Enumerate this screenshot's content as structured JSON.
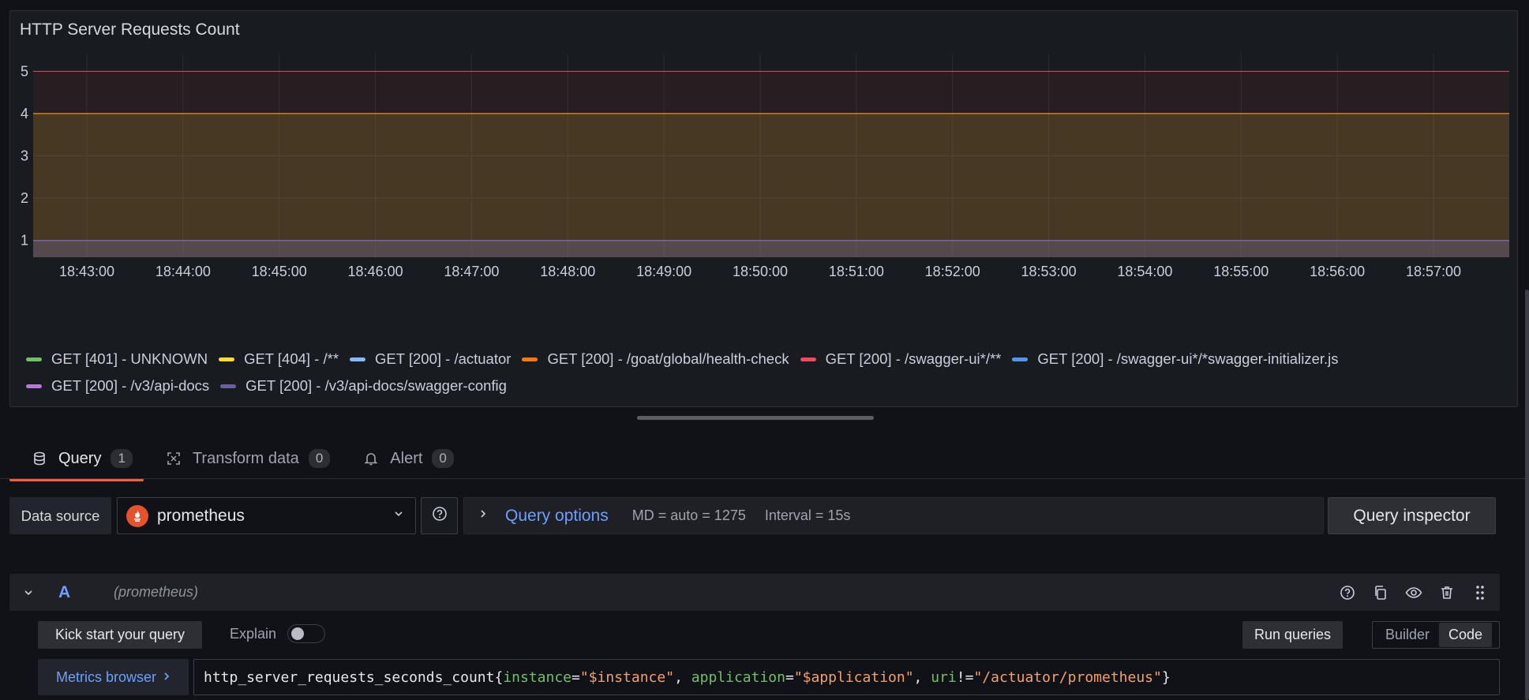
{
  "panel": {
    "title": "HTTP Server Requests Count"
  },
  "chart_data": {
    "type": "area",
    "x": [
      "18:43:00",
      "18:44:00",
      "18:45:00",
      "18:46:00",
      "18:47:00",
      "18:48:00",
      "18:49:00",
      "18:50:00",
      "18:51:00",
      "18:52:00",
      "18:53:00",
      "18:54:00",
      "18:55:00",
      "18:56:00",
      "18:57:00"
    ],
    "y_ticks": [
      "1",
      "2",
      "3",
      "4",
      "5"
    ],
    "ylim": [
      0.6,
      5.4
    ],
    "grid": true,
    "legend_placement": "bottom",
    "series": [
      {
        "name": "GET [401] - UNKNOWN",
        "color": "#73bf69",
        "value": 4
      },
      {
        "name": "GET [404] - /**",
        "color": "#fade2a",
        "value": 4
      },
      {
        "name": "GET [200] - /actuator",
        "color": "#8ab8ff",
        "value": 1
      },
      {
        "name": "GET [200] - /goat/global/health-check",
        "color": "#ff780a",
        "value": 4
      },
      {
        "name": "GET [200] - /swagger-ui*/**",
        "color": "#f2495c",
        "value": 5
      },
      {
        "name": "GET [200] - /swagger-ui*/*swagger-initializer.js",
        "color": "#5794f2",
        "value": 1
      },
      {
        "name": "GET [200] - /v3/api-docs",
        "color": "#b877d9",
        "value": 1
      },
      {
        "name": "GET [200] - /v3/api-docs/swagger-config",
        "color": "#705da0",
        "value": 1
      }
    ]
  },
  "tabs": [
    {
      "label": "Query",
      "count": "1",
      "icon": "database-icon"
    },
    {
      "label": "Transform data",
      "count": "0",
      "icon": "transform-icon"
    },
    {
      "label": "Alert",
      "count": "0",
      "icon": "bell-icon"
    }
  ],
  "datasource": {
    "label": "Data source",
    "name": "prometheus"
  },
  "query_options": {
    "title": "Query options",
    "md": "MD = auto = 1275",
    "interval": "Interval = 15s"
  },
  "query_inspector": "Query inspector",
  "query_row": {
    "ref": "A",
    "datasource": "(prometheus)"
  },
  "editor": {
    "kick_start": "Kick start your query",
    "explain": "Explain",
    "run_queries": "Run queries",
    "modes": [
      "Builder",
      "Code"
    ],
    "active_mode": "Code",
    "metrics_browser": "Metrics browser",
    "code": {
      "metric": "http_server_requests_seconds_count",
      "open": "{",
      "l1": "instance",
      "op1": "=",
      "v1": "\"$instance\"",
      "sep1": ", ",
      "l2": "application",
      "op2": "=",
      "v2": "\"$application\"",
      "sep2": ", ",
      "l3": "uri",
      "op3": "!=",
      "v3": "\"/actuator/prometheus\"",
      "close": "}"
    }
  }
}
